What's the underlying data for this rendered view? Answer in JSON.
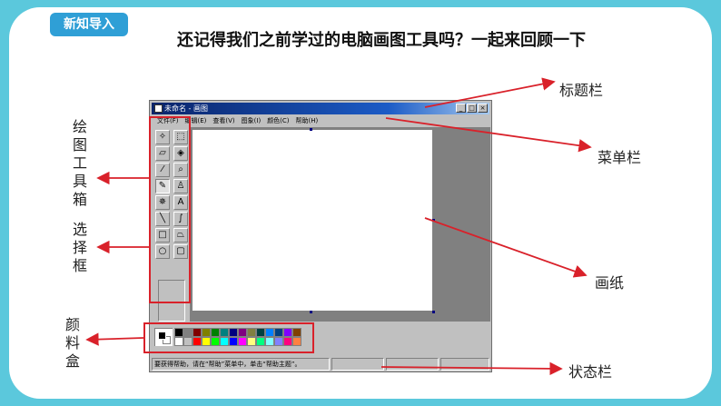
{
  "slide": {
    "badge": "新知导入",
    "headline": "还记得我们之前学过的电脑画图工具吗？一起来回顾一下"
  },
  "paint_window": {
    "title": "未命名 - 画图",
    "window_buttons": [
      "_",
      "□",
      "×"
    ],
    "menu": [
      "文件(F)",
      "编辑(E)",
      "查看(V)",
      "图象(I)",
      "颜色(C)",
      "帮助(H)"
    ],
    "tools": [
      {
        "name": "free-select-tool",
        "glyph": "✧"
      },
      {
        "name": "rect-select-tool",
        "glyph": "⬚"
      },
      {
        "name": "eraser-tool",
        "glyph": "▱"
      },
      {
        "name": "fill-tool",
        "glyph": "◈"
      },
      {
        "name": "color-picker-tool",
        "glyph": "⁄"
      },
      {
        "name": "magnifier-tool",
        "glyph": "⌕"
      },
      {
        "name": "pencil-tool",
        "glyph": "✎"
      },
      {
        "name": "brush-tool",
        "glyph": "♙"
      },
      {
        "name": "airbrush-tool",
        "glyph": "✵"
      },
      {
        "name": "text-tool",
        "glyph": "A"
      },
      {
        "name": "line-tool",
        "glyph": "╲"
      },
      {
        "name": "curve-tool",
        "glyph": "∫"
      },
      {
        "name": "rectangle-tool",
        "glyph": "□"
      },
      {
        "name": "polygon-tool",
        "glyph": "⏢"
      },
      {
        "name": "ellipse-tool",
        "glyph": "○"
      },
      {
        "name": "rounded-rect-tool",
        "glyph": "▢"
      }
    ],
    "palette_colors": [
      "#000000",
      "#808080",
      "#800000",
      "#808000",
      "#008000",
      "#008080",
      "#000080",
      "#800080",
      "#808040",
      "#004040",
      "#0080ff",
      "#004080",
      "#8000ff",
      "#804000",
      "#ffffff",
      "#c0c0c0",
      "#ff0000",
      "#ffff00",
      "#00ff00",
      "#00ffff",
      "#0000ff",
      "#ff00ff",
      "#ffff80",
      "#00ff80",
      "#80ffff",
      "#8080ff",
      "#ff0080",
      "#ff8040"
    ],
    "status_text": "要获得帮助，请在“帮助”菜单中，单击“帮助主题”。"
  },
  "callouts": {
    "title_bar": "标题栏",
    "menu_bar": "菜单栏",
    "canvas": "画纸",
    "status_bar": "状态栏",
    "toolbox": "绘图工具箱",
    "select_box": "选择框",
    "palette": "颜料盒"
  },
  "accent_colors": {
    "annotation_red": "#d9212a",
    "badge_blue": "#2f9fd6",
    "frame_cyan": "#5bc8dc"
  }
}
